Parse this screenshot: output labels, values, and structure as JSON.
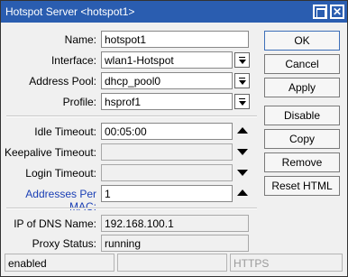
{
  "window": {
    "title": "Hotspot Server <hotspot1>"
  },
  "form": {
    "name": {
      "label": "Name:",
      "value": "hotspot1"
    },
    "interface": {
      "label": "Interface:",
      "value": "wlan1-Hotspot"
    },
    "address_pool": {
      "label": "Address Pool:",
      "value": "dhcp_pool0"
    },
    "profile": {
      "label": "Profile:",
      "value": "hsprof1"
    },
    "idle_timeout": {
      "label": "Idle Timeout:",
      "value": "00:05:00"
    },
    "keepalive_timeout": {
      "label": "Keepalive Timeout:",
      "value": ""
    },
    "login_timeout": {
      "label": "Login Timeout:",
      "value": ""
    },
    "addresses_per_mac": {
      "label": "Addresses Per MAC:",
      "value": "1"
    },
    "ip_of_dns_name": {
      "label": "IP of DNS Name:",
      "value": "192.168.100.1"
    },
    "proxy_status": {
      "label": "Proxy Status:",
      "value": "running"
    }
  },
  "buttons": {
    "ok": "OK",
    "cancel": "Cancel",
    "apply": "Apply",
    "disable": "Disable",
    "copy": "Copy",
    "remove": "Remove",
    "reset_html": "Reset HTML"
  },
  "statusbar": {
    "state": "enabled",
    "middle": "",
    "https": "HTTPS"
  },
  "colors": {
    "titlebar": "#2a5db0",
    "highlight_label": "#1a3fb5"
  }
}
